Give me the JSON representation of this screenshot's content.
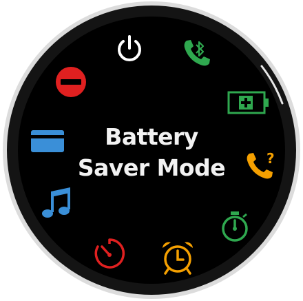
{
  "screen": {
    "title_line1": "Battery",
    "title_line2": "Saver Mode"
  },
  "controls": [
    {
      "name": "power",
      "icon": "power-icon",
      "color": "#ffffff"
    },
    {
      "name": "phone-bluetooth",
      "icon": "phone-bluetooth-icon",
      "color": "#2fa84f"
    },
    {
      "name": "battery-saver",
      "icon": "battery-charge-icon",
      "color": "#2fa84f"
    },
    {
      "name": "find-my-phone",
      "icon": "phone-question-icon",
      "color": "#f5a000"
    },
    {
      "name": "stopwatch",
      "icon": "stopwatch-icon",
      "color": "#2fa84f"
    },
    {
      "name": "alarm",
      "icon": "alarm-clock-icon",
      "color": "#f5a000"
    },
    {
      "name": "timer",
      "icon": "timer-icon",
      "color": "#e02020"
    },
    {
      "name": "music",
      "icon": "music-note-icon",
      "color": "#3a8fd8"
    },
    {
      "name": "wallet",
      "icon": "wallet-card-icon",
      "color": "#3a8fd8"
    },
    {
      "name": "do-not-disturb",
      "icon": "do-not-disturb-icon",
      "color": "#e02020"
    }
  ]
}
